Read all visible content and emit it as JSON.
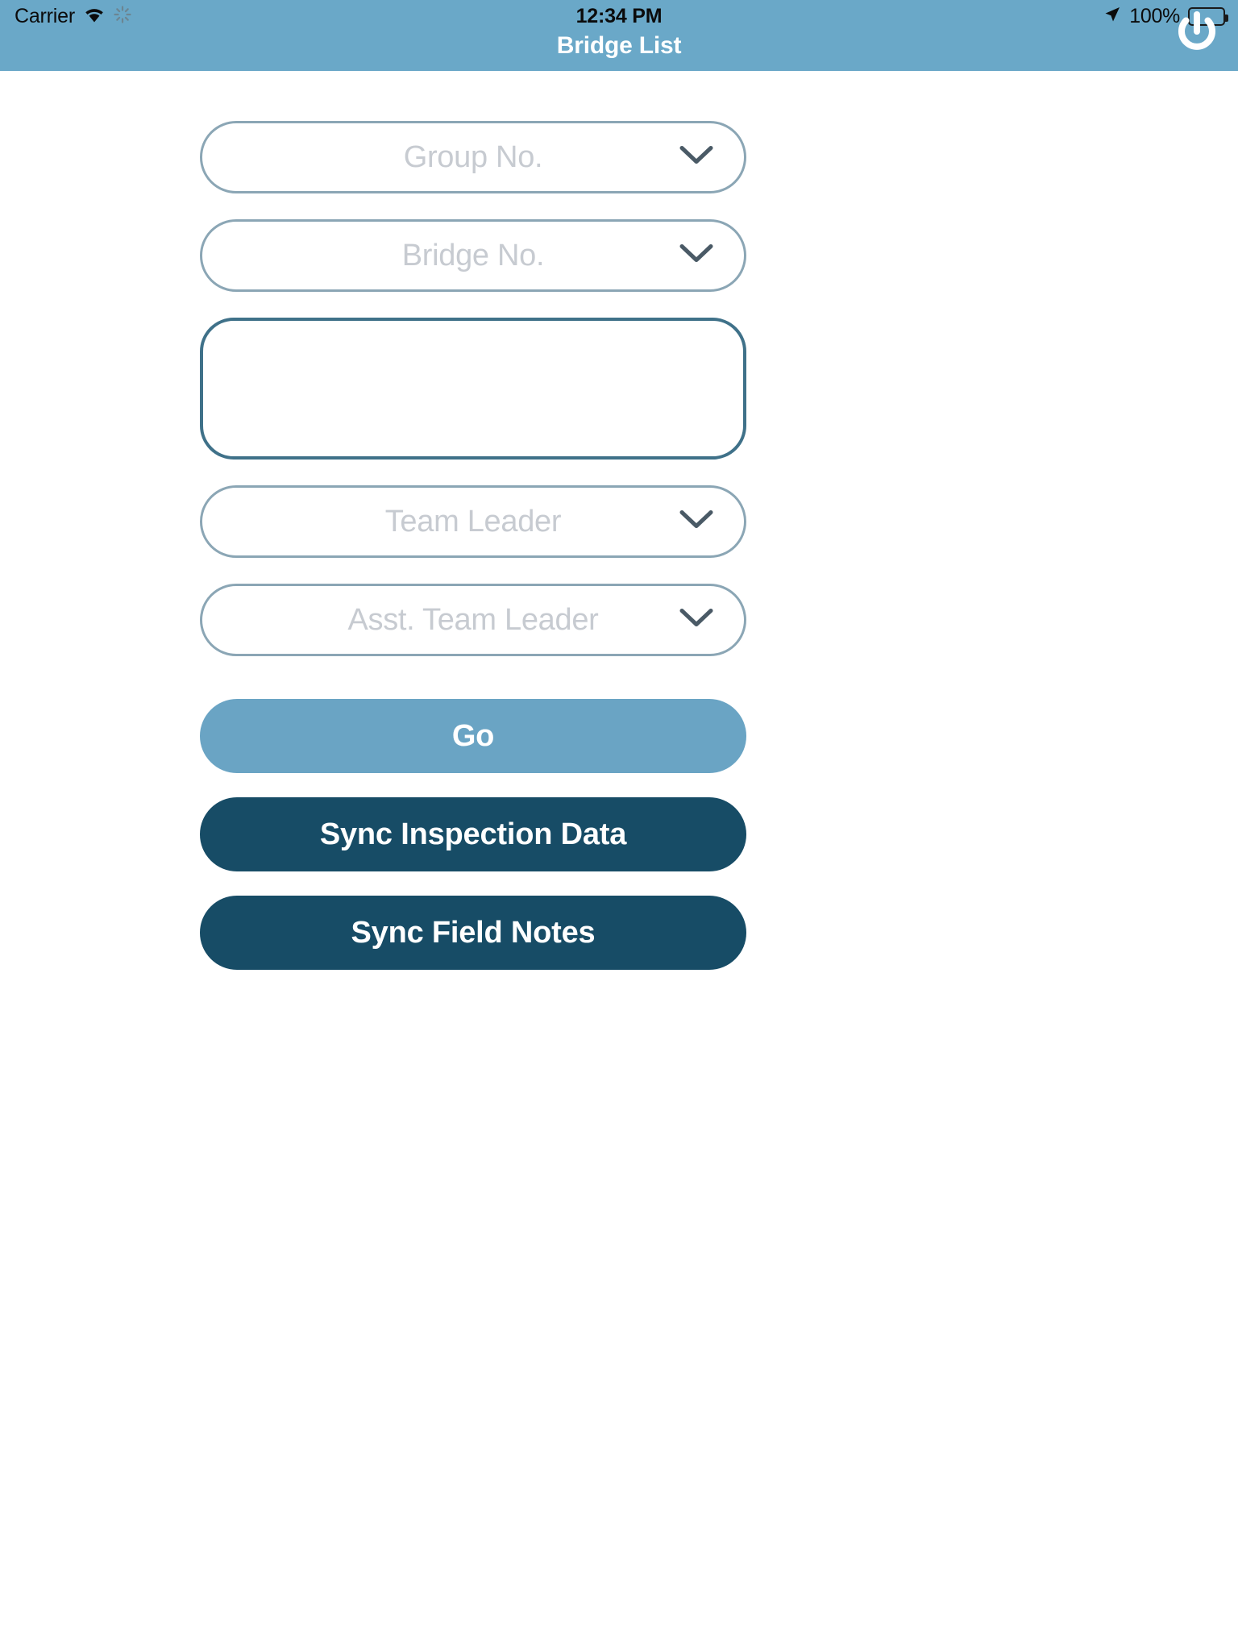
{
  "statusbar": {
    "carrier": "Carrier",
    "wifi_icon": "wifi-icon",
    "activity_icon": "spinner-icon",
    "time": "12:34 PM",
    "location_icon": "location-arrow-icon",
    "battery_percent": "100%",
    "battery_icon": "battery-full-icon"
  },
  "navbar": {
    "title": "Bridge List",
    "power_icon": "power-icon",
    "background_color": "#6aa8c8"
  },
  "form": {
    "fields": [
      {
        "name": "group-no",
        "placeholder": "Group No.",
        "value": "",
        "type": "dropdown",
        "icon": "chevron-down-icon",
        "border_color": "#8ba6b5"
      },
      {
        "name": "bridge-no",
        "placeholder": "Bridge No.",
        "value": "",
        "type": "dropdown",
        "icon": "chevron-down-icon",
        "border_color": "#8ba6b5"
      },
      {
        "name": "notes",
        "placeholder": "",
        "value": "",
        "type": "textarea",
        "border_color": "#3f7189"
      },
      {
        "name": "team-leader",
        "placeholder": "Team Leader",
        "value": "",
        "type": "dropdown",
        "icon": "chevron-down-icon",
        "border_color": "#8ba6b5"
      },
      {
        "name": "asst-team-leader",
        "placeholder": "Asst. Team Leader",
        "value": "",
        "type": "dropdown",
        "icon": "chevron-down-icon",
        "border_color": "#8ba6b5"
      }
    ]
  },
  "buttons": {
    "go": {
      "label": "Go",
      "color": "#6aa4c4"
    },
    "sync_inspection": {
      "label": "Sync Inspection Data",
      "color": "#174c66"
    },
    "sync_field_notes": {
      "label": "Sync Field Notes",
      "color": "#174c66"
    }
  }
}
